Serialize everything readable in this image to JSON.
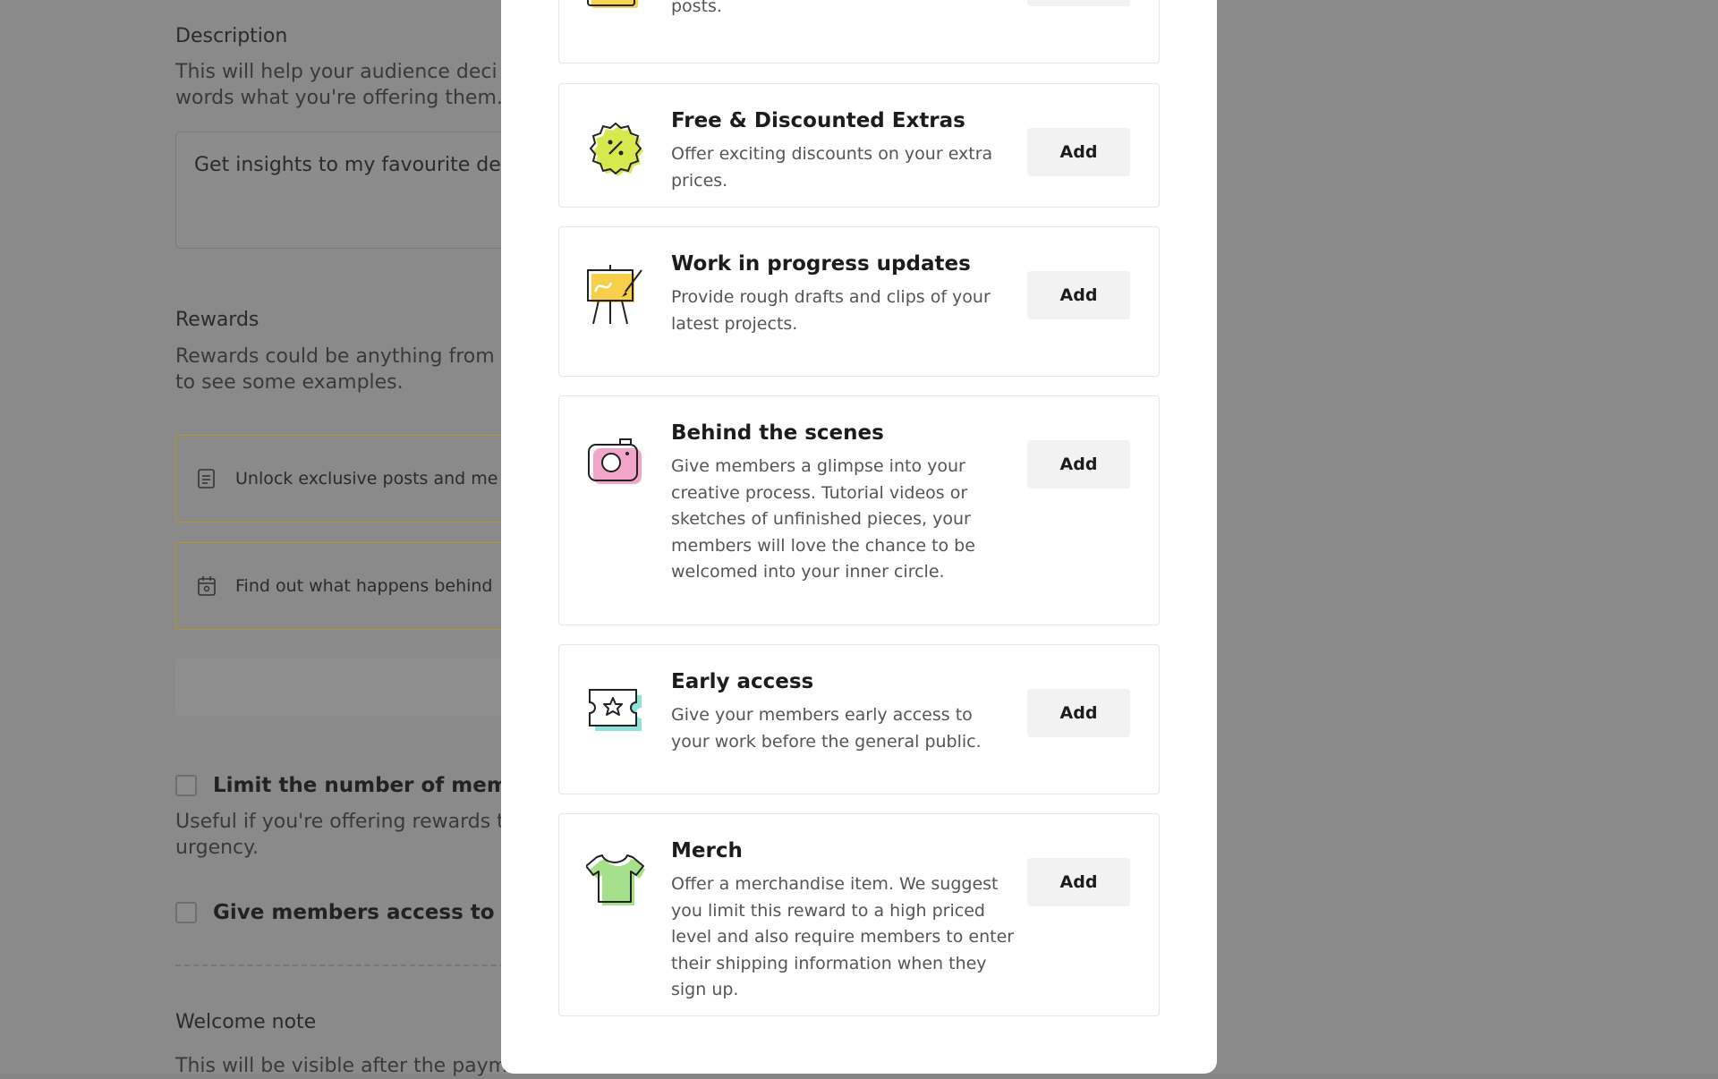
{
  "background": {
    "description_heading": "Description",
    "description_text": "This will help your audience deci",
    "description_text2": "words what you're offering them.",
    "textarea_value": "Get insights to my favourite de",
    "rewards_heading": "Rewards",
    "rewards_text": "Rewards could be anything from e",
    "rewards_text2": "to see some examples.",
    "reward_1": "Unlock exclusive posts and me",
    "reward_2": "Find out what happens behind",
    "limit_label": "Limit the number of membe",
    "limit_help": "Useful if you're offering rewards t",
    "limit_help2": "urgency.",
    "access_label": "Give members access to sel",
    "welcome_heading": "Welcome note",
    "welcome_text": "This will be visible after the payme"
  },
  "modal": {
    "top_card_tail": "posts.",
    "add_label": "Add",
    "cards": [
      {
        "title": "Free & Discounted Extras",
        "desc": "Offer exciting discounts on your extra prices.",
        "icon": "discount-badge-icon"
      },
      {
        "title": "Work in progress updates",
        "desc": "Provide rough drafts and clips of your latest projects.",
        "icon": "easel-icon"
      },
      {
        "title": "Behind the scenes",
        "desc": "Give members a glimpse into your creative process. Tutorial videos or sketches of unfinished pieces, your members will love the chance to be welcomed into your inner circle.",
        "icon": "camera-icon"
      },
      {
        "title": "Early access",
        "desc": "Give your members early access to your work before the general public.",
        "icon": "ticket-star-icon"
      },
      {
        "title": "Merch",
        "desc": "Offer a merchandise item. We suggest you limit this reward to a high priced level and also require members to enter their shipping information when they sign up.",
        "icon": "tshirt-icon"
      }
    ]
  },
  "colors": {
    "overlay": "#858585",
    "modal_bg": "#ffffff",
    "card_border": "#e6e6e6",
    "button_bg": "#f2f2f2",
    "reward_border": "#b3932a"
  }
}
